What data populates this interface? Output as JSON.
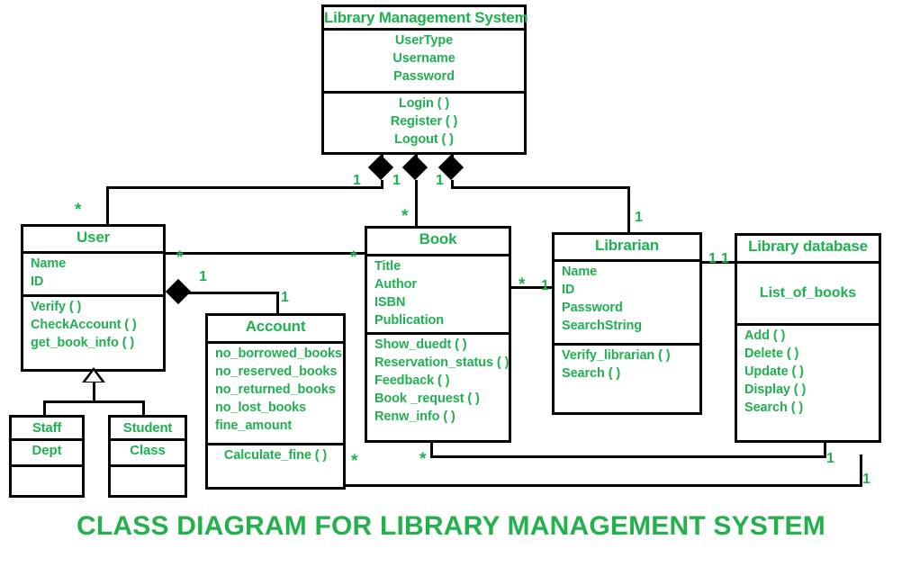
{
  "caption": "CLASS DIAGRAM FOR LIBRARY MANAGEMENT SYSTEM",
  "colors": {
    "text_green": "#1fb050",
    "caption_green": "#22b14c",
    "line_black": "#000000",
    "background": "#ffffff"
  },
  "classes": {
    "lms": {
      "name": "Library Management System",
      "attributes": [
        "UserType",
        "Username",
        "Password"
      ],
      "operations": [
        "Login ( )",
        "Register ( )",
        "Logout ( )"
      ]
    },
    "user": {
      "name": "User",
      "attributes": [
        "Name",
        "ID"
      ],
      "operations": [
        "Verify ( )",
        "CheckAccount ( )",
        "get_book_info ( )"
      ]
    },
    "book": {
      "name": "Book",
      "attributes": [
        "Title",
        "Author",
        "ISBN",
        "Publication"
      ],
      "operations": [
        "Show_duedt ( )",
        "Reservation_status ( )",
        "Feedback ( )",
        "Book _request ( )",
        "Renw_info ( )"
      ]
    },
    "librarian": {
      "name": "Librarian",
      "attributes": [
        "Name",
        "ID",
        "Password",
        "SearchString"
      ],
      "operations": [
        "Verify_librarian ( )",
        "Search ( )"
      ]
    },
    "library_database": {
      "name": "Library database",
      "attributes": [
        "List_of_books"
      ],
      "operations": [
        "Add ( )",
        "Delete ( )",
        "Update ( )",
        "Display ( )",
        "Search ( )"
      ]
    },
    "account": {
      "name": "Account",
      "attributes": [
        "no_borrowed_books",
        "no_reserved_books",
        "no_returned_books",
        "no_lost_books",
        "fine_amount"
      ],
      "operations": [
        "Calculate_fine ( )"
      ]
    },
    "staff": {
      "name": "Staff",
      "attributes": [
        "Dept"
      ],
      "operations": []
    },
    "student": {
      "name": "Student",
      "attributes": [
        "Class"
      ],
      "operations": []
    }
  },
  "multiplicities": {
    "lms_user_one": "1",
    "lms_book_one": "1",
    "lms_librarian_one": "1",
    "user_top_many": "*",
    "user_right_many": "*",
    "book_top_many": "*",
    "book_left_many": "*",
    "librarian_top_one": "1",
    "user_account_one": "1",
    "account_one": "1",
    "book_librarian_many": "*",
    "book_librarian_one": "1",
    "librarian_db_one_a": "1",
    "librarian_db_one_b": "1",
    "account_bottom_many": "*",
    "book_bottom_many": "*",
    "db_bottom_one": "1",
    "db_bottom_one_b": "1"
  }
}
